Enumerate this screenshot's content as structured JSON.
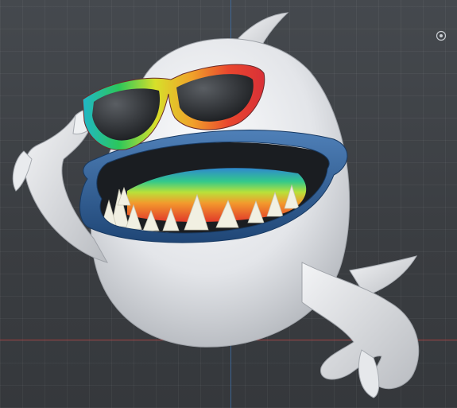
{
  "viewport": {
    "background_color": "#3b3e42",
    "grid": true,
    "axis_colors": {
      "x": "#a43b3b",
      "y": "#3f6fa8"
    }
  },
  "overlay": {
    "icon": "view-gizmo-icon"
  },
  "model": {
    "object": "3d-monster-character",
    "materials": {
      "skin": "#e4e6ea",
      "lip_ring": "#2c5a8f",
      "glasses_frame": "rainbow",
      "teeth": "#f2f1e4",
      "tongue": "rainbow"
    }
  }
}
